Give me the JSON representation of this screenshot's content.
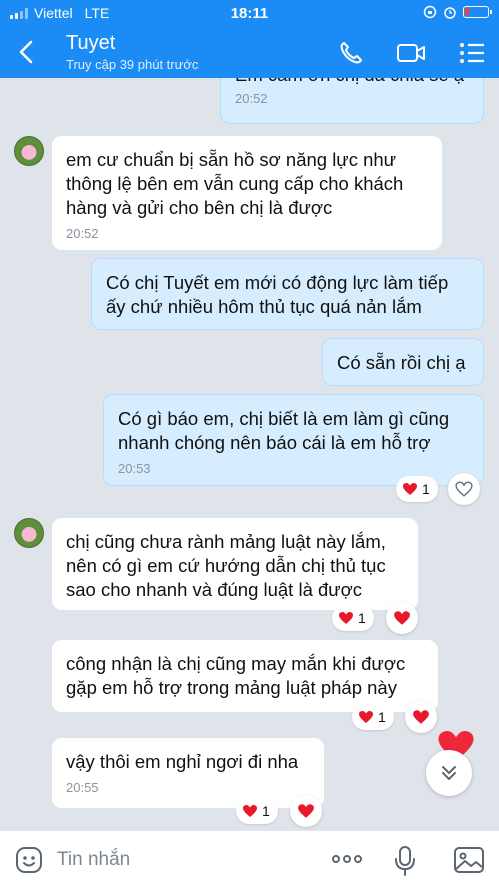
{
  "status_bar": {
    "carrier": "Viettel",
    "network": "LTE",
    "time": "18:11",
    "battery_level": 0.2,
    "battery_color": "#ff3b30"
  },
  "header": {
    "contact_name": "Tuyet",
    "last_seen": "Truy cập 39 phút trước",
    "icons": [
      "back-icon",
      "phone-icon",
      "video-call-icon",
      "menu-list-icon"
    ],
    "accent_color": "#1b8cf5"
  },
  "messages": [
    {
      "direction": "sent",
      "text": "Em cảm ơn chị đã chia sẻ ạ",
      "time": "20:52"
    },
    {
      "direction": "received",
      "lines": [
        "em cư chuẩn bị sẵn hồ sơ năng lực như",
        "thông lệ bên em vẫn cung cấp cho khách",
        "hàng và gửi cho bên chị là được"
      ],
      "time": "20:52"
    },
    {
      "direction": "sent",
      "lines": [
        "Có chị Tuyết em mới có động lực làm tiếp",
        "ấy chứ nhiều hôm thủ tục quá nản lắm"
      ]
    },
    {
      "direction": "sent",
      "text": "Có sẵn rồi chị ạ"
    },
    {
      "direction": "sent",
      "lines": [
        "Có gì báo em, chị biết là em làm gì cũng",
        "nhanh chóng nên báo cái là em hỗ trợ"
      ],
      "time": "20:53",
      "reaction_count": "1"
    },
    {
      "direction": "received",
      "lines": [
        "chị cũng chưa rành mảng luật này lắm,",
        "nên có gì em cứ hướng dẫn chị thủ tục",
        "sao cho nhanh và đúng luật là được"
      ],
      "reaction_count": "1"
    },
    {
      "direction": "received",
      "lines": [
        "công nhận là chị cũng may mắn khi được",
        "gặp em hỗ trợ trong mảng luật pháp này"
      ],
      "reaction_count": "1"
    },
    {
      "direction": "received",
      "text": "vậy thôi em nghỉ ngơi đi nha",
      "time": "20:55",
      "reaction_count": "1"
    }
  ],
  "input": {
    "placeholder": "Tin nhắn",
    "icons": [
      "sticker-icon",
      "more-icon",
      "microphone-icon",
      "image-icon"
    ]
  },
  "colors": {
    "sent_bubble": "#d5edff",
    "received_bubble": "#ffffff",
    "chat_background": "#dfe4ea",
    "heart": "#e8192c"
  }
}
